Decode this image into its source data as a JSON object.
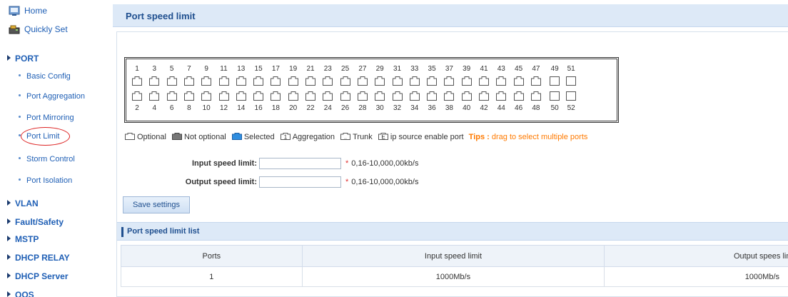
{
  "sidebar": {
    "home": "Home",
    "quickly_set": "Quickly Set",
    "port": "PORT",
    "port_items": [
      "Basic Config",
      "Port Aggregation",
      "Port Mirroring",
      "Port Limit",
      "Storm Control",
      "Port Isolation"
    ],
    "sections": [
      "VLAN",
      "Fault/Safety",
      "MSTP",
      "DHCP RELAY",
      "DHCP Server",
      "QOS"
    ]
  },
  "page": {
    "title": "Port speed limit"
  },
  "ports": {
    "top": [
      "1",
      "3",
      "5",
      "7",
      "9",
      "11",
      "13",
      "15",
      "17",
      "19",
      "21",
      "23",
      "25",
      "27",
      "29",
      "31",
      "33",
      "35",
      "37",
      "39",
      "41",
      "43",
      "45",
      "47",
      "49",
      "51"
    ],
    "bottom": [
      "2",
      "4",
      "6",
      "8",
      "10",
      "12",
      "14",
      "16",
      "18",
      "20",
      "22",
      "24",
      "26",
      "28",
      "30",
      "32",
      "34",
      "36",
      "38",
      "40",
      "42",
      "44",
      "46",
      "48",
      "50",
      "52"
    ]
  },
  "legend": {
    "optional": "Optional",
    "not_optional": "Not optional",
    "selected": "Selected",
    "aggregation": "Aggregation",
    "aggregation_glyph": "1",
    "trunk": "Trunk",
    "trunk_glyph": "..",
    "ip_source": "ip source enable port",
    "ip_source_glyph": "E",
    "tips_label": "Tips :",
    "tips_text": "drag to select multiple ports"
  },
  "form": {
    "input_label": "Input speed limit:",
    "input_value": "",
    "input_hint": "0,16-10,000,00kb/s",
    "output_label": "Output speed limit:",
    "output_value": "",
    "output_hint": "0,16-10,000,00kb/s",
    "required_mark": "*",
    "save": "Save settings"
  },
  "list": {
    "title": "Port speed limit list",
    "columns": [
      "Ports",
      "Input speed limit",
      "Output spees limit"
    ],
    "rows": [
      [
        "1",
        "1000Mb/s",
        "1000Mb/s"
      ]
    ]
  },
  "colors": {
    "accent": "#1f4f8f",
    "link": "#1f5fb5",
    "tips": "#ff7a00",
    "header_bg": "#dde9f7",
    "selected_port": "#2f8ee0"
  }
}
